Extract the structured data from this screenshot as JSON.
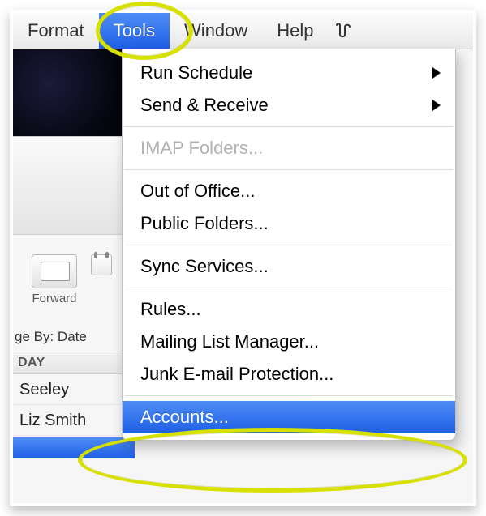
{
  "menubar": {
    "items": [
      {
        "label": "Format",
        "selected": false
      },
      {
        "label": "Tools",
        "selected": true
      },
      {
        "label": "Window",
        "selected": false
      },
      {
        "label": "Help",
        "selected": false
      }
    ],
    "script_icon": "script-menu-icon"
  },
  "dropdown": [
    {
      "type": "item",
      "label": "Run Schedule",
      "submenu": true
    },
    {
      "type": "item",
      "label": "Send & Receive",
      "submenu": true
    },
    {
      "type": "sep"
    },
    {
      "type": "item",
      "label": "IMAP Folders...",
      "disabled": true
    },
    {
      "type": "sep"
    },
    {
      "type": "item",
      "label": "Out of Office..."
    },
    {
      "type": "item",
      "label": "Public Folders..."
    },
    {
      "type": "sep"
    },
    {
      "type": "item",
      "label": "Sync Services..."
    },
    {
      "type": "sep"
    },
    {
      "type": "item",
      "label": "Rules..."
    },
    {
      "type": "item",
      "label": "Mailing List Manager..."
    },
    {
      "type": "item",
      "label": "Junk E-mail Protection..."
    },
    {
      "type": "sep"
    },
    {
      "type": "item",
      "label": "Accounts...",
      "highlight": true
    }
  ],
  "background": {
    "forward_label": "Forward",
    "arrange_label": "ge By: Date",
    "section_header": "DAY",
    "rows": [
      "Seeley",
      "Liz Smith"
    ]
  },
  "annotations": {
    "circled_menu": "Tools",
    "circled_item": "Accounts..."
  }
}
